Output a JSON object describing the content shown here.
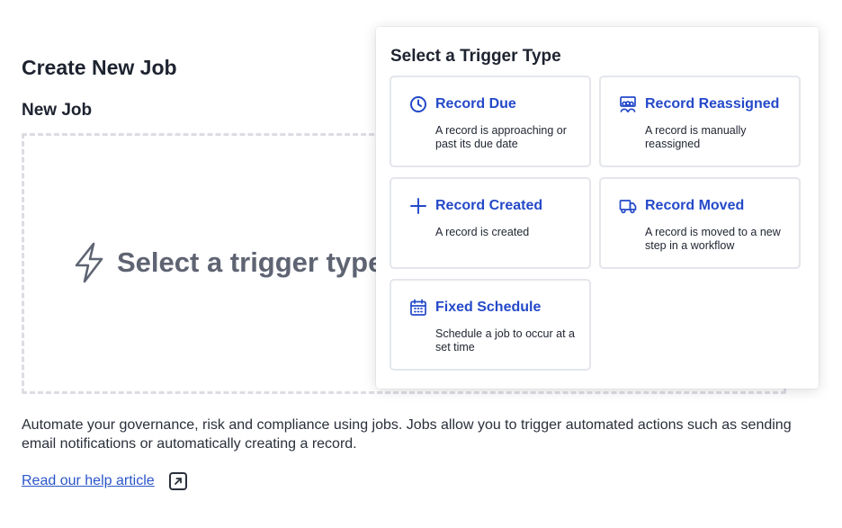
{
  "page": {
    "title": "Create New Job",
    "section_title": "New Job",
    "dropzone_prompt": "Select a trigger type",
    "description": "Automate your governance, risk and compliance using jobs. Jobs allow you to trigger automated actions such as sending email notifications or automatically creating a record.",
    "help_link": "Read our help article"
  },
  "popover": {
    "title": "Select a Trigger Type",
    "options": [
      {
        "label": "Record Due",
        "description": "A record is approaching or past its due date",
        "icon": "clock-icon"
      },
      {
        "label": "Record Reassigned",
        "description": "A record is manually reassigned",
        "icon": "users-presentation-icon"
      },
      {
        "label": "Record Created",
        "description": "A record is created",
        "icon": "plus-icon"
      },
      {
        "label": "Record Moved",
        "description": "A record is moved to a new step in a workflow",
        "icon": "truck-icon"
      },
      {
        "label": "Fixed Schedule",
        "description": "Schedule a job to occur at a set time",
        "icon": "calendar-icon"
      }
    ]
  },
  "colors": {
    "accent": "#2449c9",
    "link": "#2b56c9",
    "muted_text": "#5f6473",
    "card_border": "#e4e6ec",
    "dashed_border": "#dcdde3"
  }
}
